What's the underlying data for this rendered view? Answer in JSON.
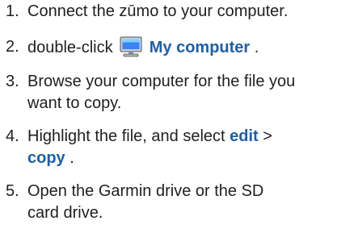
{
  "steps": [
    {
      "number": "1.",
      "text": "Connect the zūmo to your computer."
    },
    {
      "number": "2.",
      "before": "double-click",
      "icon": "my-computer-icon",
      "ui_label": "My computer",
      "after": "."
    },
    {
      "number": "3.",
      "line1": "Browse your computer for the file you",
      "line2": "want to copy."
    },
    {
      "number": "4.",
      "before": "Highlight the file, and select",
      "menu": "edit",
      "separator": ">",
      "command": "copy",
      "after": "."
    },
    {
      "number": "5.",
      "line1": "Open the Garmin drive or the SD",
      "line2": "card drive."
    }
  ],
  "colors": {
    "text": "#1f1f1f",
    "ui_text": "#1d5fa8"
  }
}
